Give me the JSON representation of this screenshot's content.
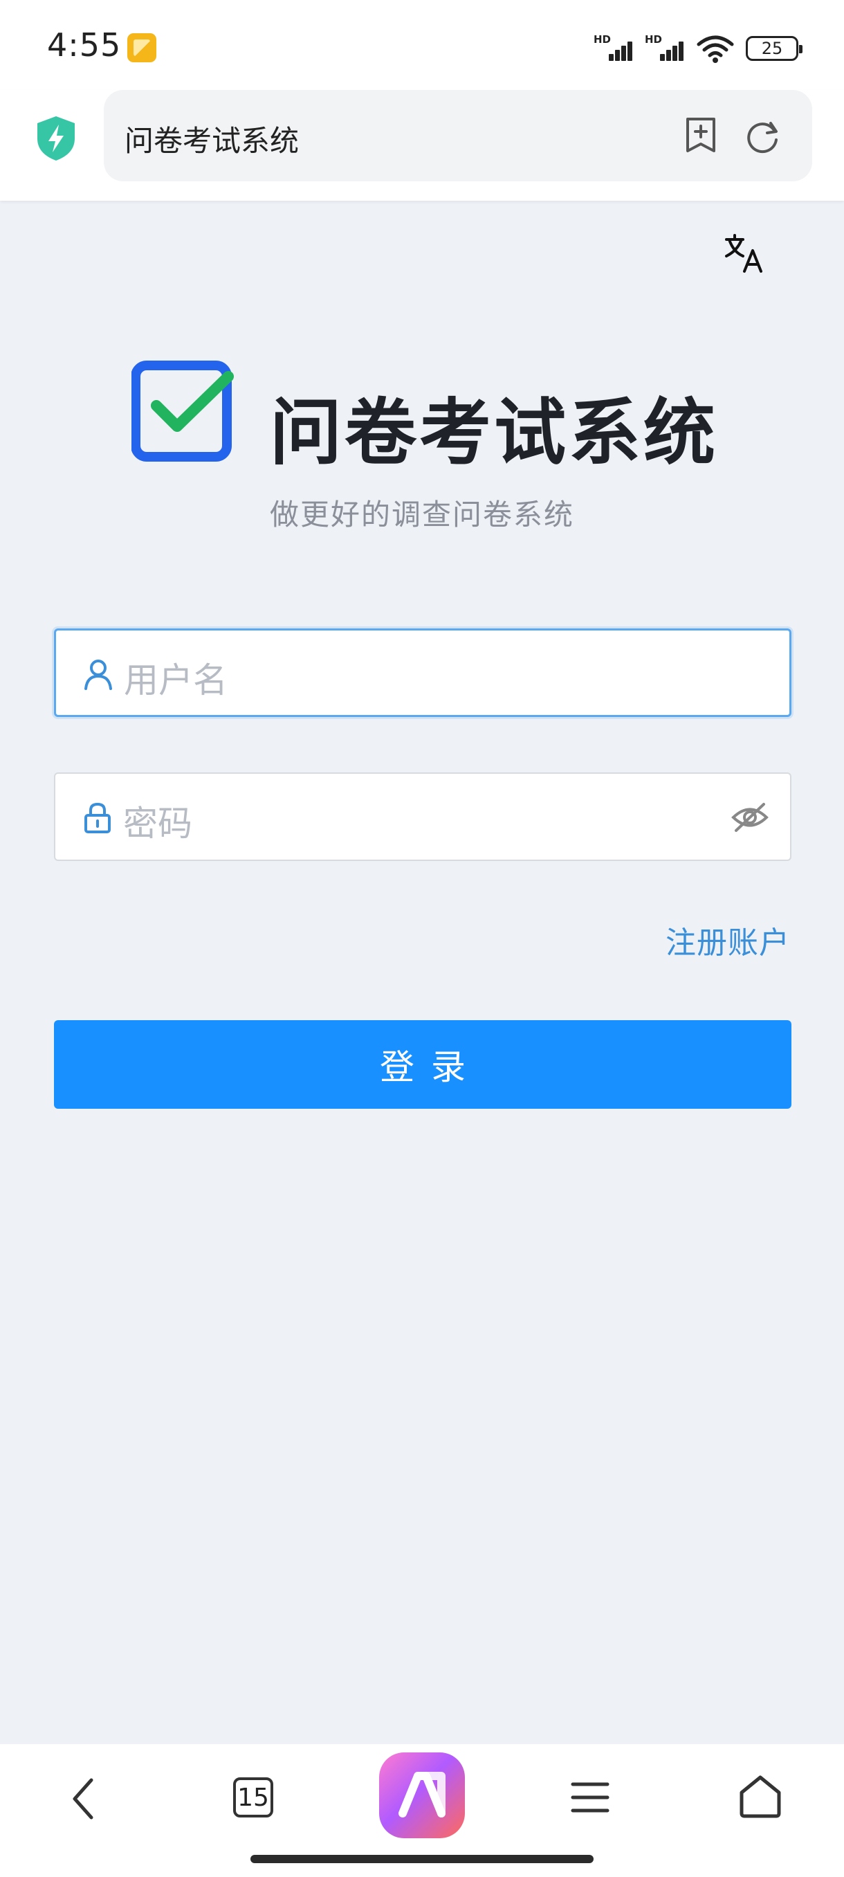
{
  "status_bar": {
    "time": "4:55",
    "battery": "25",
    "signal_label": "HD"
  },
  "browser": {
    "title": "问卷考试系统"
  },
  "login": {
    "app_title": "问卷考试系统",
    "subtitle": "做更好的调查问卷系统",
    "username_placeholder": "用户名",
    "password_placeholder": "密码",
    "register_link": "注册账户",
    "login_button": "登录"
  },
  "bottom_nav": {
    "tab_count": "15"
  },
  "colors": {
    "primary": "#1890ff",
    "link": "#3a8fd8",
    "logo_blue": "#2463eb",
    "check_green": "#22b35e",
    "page_bg": "#eef1f5"
  }
}
